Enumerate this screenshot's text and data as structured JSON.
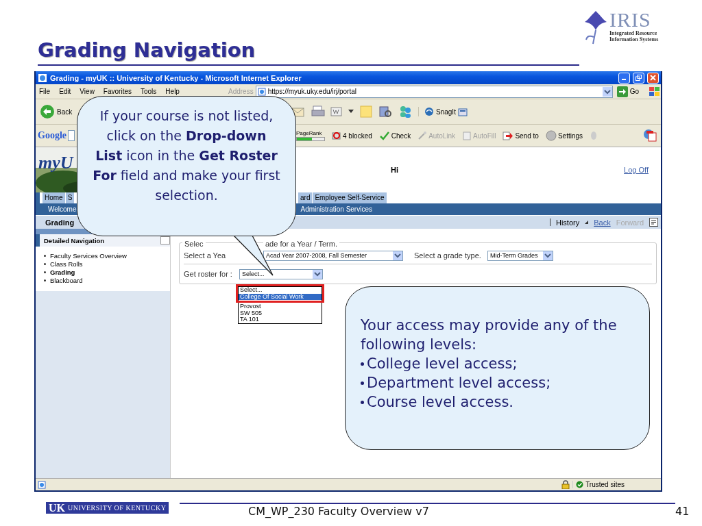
{
  "slide": {
    "title": "Grading Navigation",
    "logo_text": "IRIS",
    "logo_subtitle": "Integrated Resource Information Systems",
    "footer_logo_mark": "UK",
    "footer_logo_text": "UNIVERSITY OF KENTUCKY",
    "footer_text": "CM_WP_230 Faculty Overview v7",
    "page_number": "41"
  },
  "window": {
    "title": "Grading - myUK :: University of Kentucky - Microsoft Internet Explorer"
  },
  "menu": [
    "File",
    "Edit",
    "View",
    "Favorites",
    "Tools",
    "Help"
  ],
  "address": {
    "label": "Address",
    "value": "https://myuk.uky.edu/irj/portal",
    "go": "Go"
  },
  "toolbar": {
    "back": "Back",
    "snagit": "SnagIt"
  },
  "google_bar": {
    "logo": "Google",
    "items": [
      {
        "kind": "pagerank",
        "label": "PageRank",
        "disabled": false
      },
      {
        "kind": "blocked",
        "label": "4 blocked",
        "disabled": false
      },
      {
        "kind": "check",
        "label": "Check",
        "disabled": false
      },
      {
        "kind": "autolink",
        "label": "AutoLink",
        "disabled": true
      },
      {
        "kind": "autofill",
        "label": "AutoFill",
        "disabled": true
      },
      {
        "kind": "sendto",
        "label": "Send to",
        "disabled": false
      },
      {
        "kind": "settings",
        "label": "Settings",
        "disabled": false
      }
    ]
  },
  "portal": {
    "logo": "myU",
    "greeting": "Hi",
    "logoff": "Log Off",
    "tabs_left": [
      "Home",
      "S"
    ],
    "tabs_right": [
      "ard",
      "Employee Self-Service"
    ],
    "subnav_left": "Welcome",
    "subnav_right": "Administration Services",
    "page_title": "Grading",
    "history": "History",
    "back": "Back",
    "forward": "Forward"
  },
  "nav": {
    "title": "Detailed Navigation",
    "items": [
      {
        "label": "Faculty Services Overview",
        "selected": false
      },
      {
        "label": "Class Rolls",
        "selected": false
      },
      {
        "label": "Grading",
        "selected": true
      },
      {
        "label": "Blackboard",
        "selected": false
      }
    ]
  },
  "form": {
    "legend_start": "Selec",
    "legend_end": "ade for a Year / Term.",
    "year_label": "Select a Yea",
    "year_value": "Acad Year 2007-2008, Fall Semester",
    "grade_label": "Select a grade type.",
    "grade_value": "Mid-Term Grades",
    "roster_label": "Get roster for :",
    "roster_value": "Select...",
    "roster_options": [
      {
        "label": "Select...",
        "selected": false
      },
      {
        "label": "College Of Social Work",
        "selected": true
      },
      {
        "label": "Provost",
        "selected": false
      },
      {
        "label": "SW 505",
        "selected": false
      },
      {
        "label": "TA 101",
        "selected": false
      }
    ]
  },
  "status_bar": {
    "zone": "Trusted sites"
  },
  "callouts": [
    {
      "text": "If your course is not listed, click on the **Drop-down List** icon in the **Get Roster For** field and make your first selection."
    },
    {
      "text": "Your access may provide any of the following levels:",
      "bullets": [
        "College level access;",
        "Department level access;",
        "Course level access."
      ]
    }
  ]
}
